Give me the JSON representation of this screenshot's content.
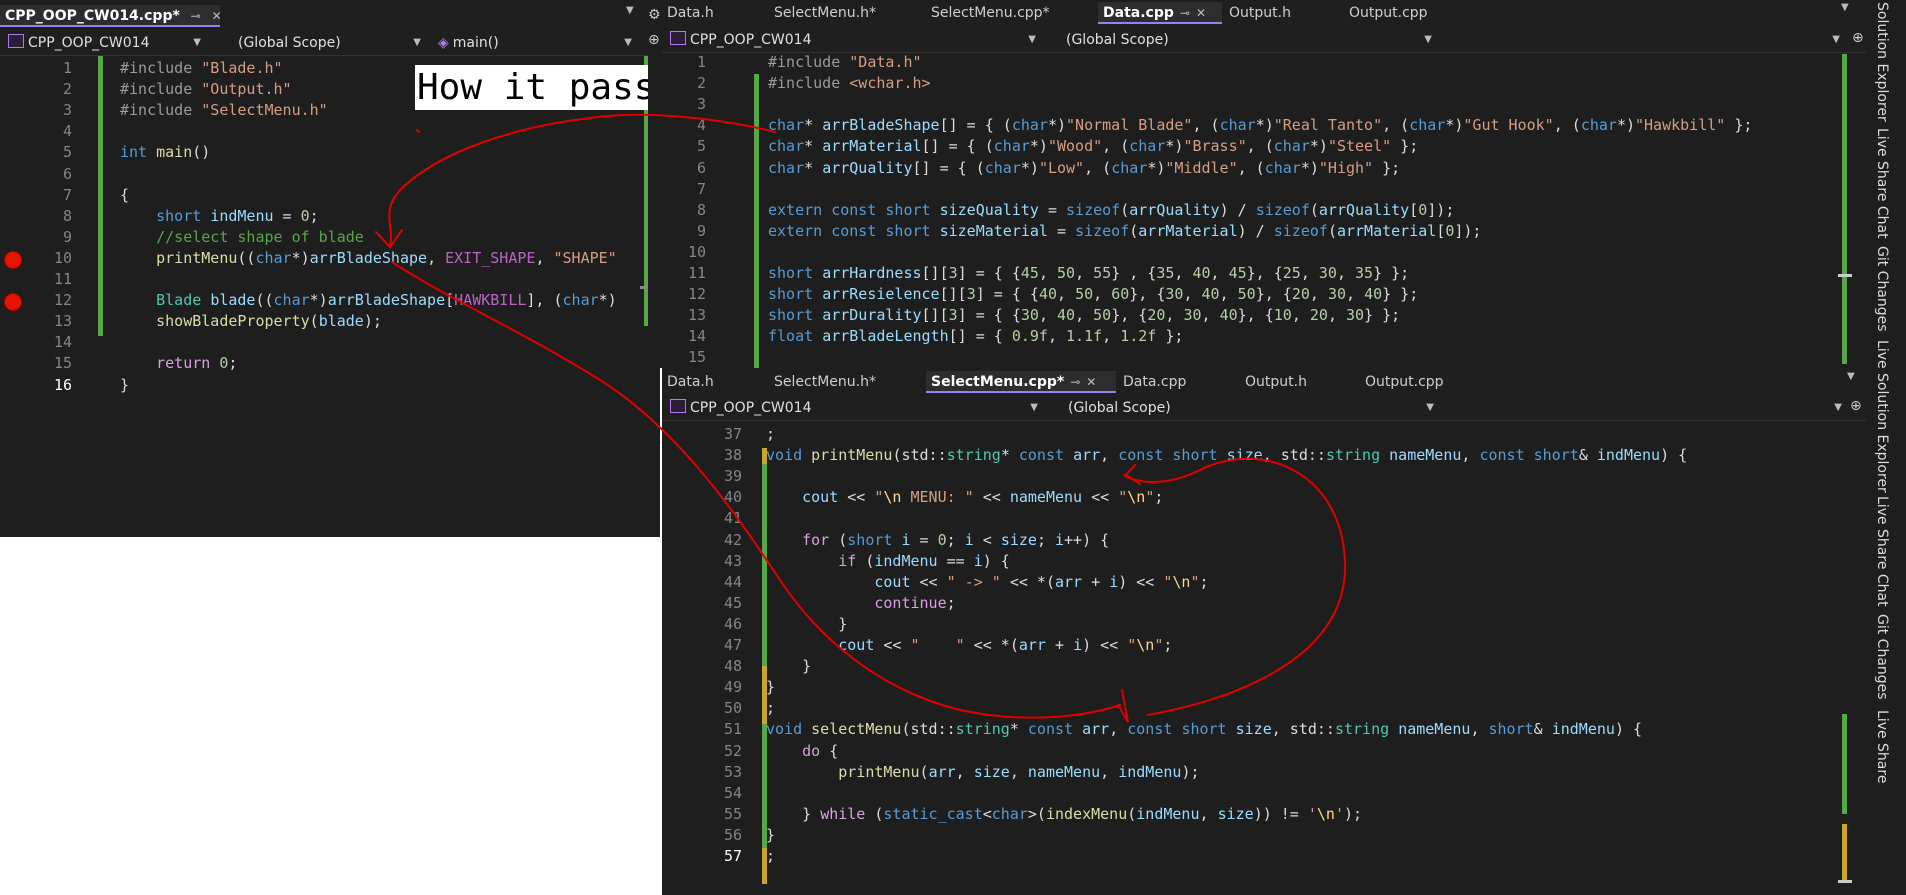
{
  "left_pane": {
    "tabs": [
      {
        "label": "CPP_OOP_CW014.cpp*"
      }
    ],
    "nav": {
      "project": "CPP_OOP_CW014",
      "scope": "(Global Scope)",
      "member": "main()"
    },
    "lines": [
      {
        "n": "1",
        "t": "#include \"Blade.h\""
      },
      {
        "n": "2",
        "t": "#include \"Output.h\""
      },
      {
        "n": "3",
        "t": "#include \"SelectMenu.h\""
      },
      {
        "n": "4",
        "t": ""
      },
      {
        "n": "5",
        "t": "int main()"
      },
      {
        "n": "6",
        "t": ""
      },
      {
        "n": "7",
        "t": "{"
      },
      {
        "n": "8",
        "t": "    short indMenu = 0;"
      },
      {
        "n": "9",
        "t": "    //select shape of blade"
      },
      {
        "n": "10",
        "t": "    printMenu((char*)arrBladeShape, EXIT_SHAPE, \"SHAPE\""
      },
      {
        "n": "11",
        "t": ""
      },
      {
        "n": "12",
        "t": "    Blade blade((char*)arrBladeShape[HAWKBILL], (char*)"
      },
      {
        "n": "13",
        "t": "    showBladeProperty(blade);"
      },
      {
        "n": "14",
        "t": ""
      },
      {
        "n": "15",
        "t": "    return 0;"
      },
      {
        "n": "16",
        "t": "}"
      }
    ]
  },
  "annotation": {
    "text": "How it pass?"
  },
  "top_right_pane": {
    "tabs": [
      {
        "label": "Data.h"
      },
      {
        "label": "SelectMenu.h*"
      },
      {
        "label": "SelectMenu.cpp*"
      },
      {
        "label": "Data.cpp"
      },
      {
        "label": "Output.h"
      },
      {
        "label": "Output.cpp"
      }
    ],
    "nav": {
      "project": "CPP_OOP_CW014",
      "scope": "(Global Scope)"
    },
    "lines": [
      {
        "n": "1",
        "t": "#include \"Data.h\""
      },
      {
        "n": "2",
        "t": "#include <wchar.h>"
      },
      {
        "n": "3",
        "t": ""
      },
      {
        "n": "4",
        "t": "char* arrBladeShape[] = { (char*)\"Normal Blade\", (char*)\"Real Tanto\", (char*)\"Gut Hook\", (char*)\"Hawkbill\" };"
      },
      {
        "n": "5",
        "t": "char* arrMaterial[] = { (char*)\"Wood\", (char*)\"Brass\", (char*)\"Steel\" };"
      },
      {
        "n": "6",
        "t": "char* arrQuality[] = { (char*)\"Low\", (char*)\"Middle\", (char*)\"High\" };"
      },
      {
        "n": "7",
        "t": ""
      },
      {
        "n": "8",
        "t": "extern const short sizeQuality = sizeof(arrQuality) / sizeof(arrQuality[0]);"
      },
      {
        "n": "9",
        "t": "extern const short sizeMaterial = sizeof(arrMaterial) / sizeof(arrMaterial[0]);"
      },
      {
        "n": "10",
        "t": ""
      },
      {
        "n": "11",
        "t": "short arrHardness[][3] = { {45, 50, 55} , {35, 40, 45}, {25, 30, 35} };"
      },
      {
        "n": "12",
        "t": "short arrResielence[][3] = { {40, 50, 60}, {30, 40, 50}, {20, 30, 40} };"
      },
      {
        "n": "13",
        "t": "short arrDurality[][3] = { {30, 40, 50}, {20, 30, 40}, {10, 20, 30} };"
      },
      {
        "n": "14",
        "t": "float arrBladeLength[] = { 0.9f, 1.1f, 1.2f };"
      },
      {
        "n": "15",
        "t": ""
      }
    ]
  },
  "bottom_right_pane": {
    "tabs": [
      {
        "label": "Data.h"
      },
      {
        "label": "SelectMenu.h*"
      },
      {
        "label": "SelectMenu.cpp*"
      },
      {
        "label": "Data.cpp"
      },
      {
        "label": "Output.h"
      },
      {
        "label": "Output.cpp"
      }
    ],
    "nav": {
      "project": "CPP_OOP_CW014",
      "scope": "(Global Scope)"
    },
    "lines": [
      {
        "n": "37",
        "t": ";"
      },
      {
        "n": "38",
        "t": "void printMenu(std::string* const arr, const short size, std::string nameMenu, const short& indMenu) {"
      },
      {
        "n": "39",
        "t": ""
      },
      {
        "n": "40",
        "t": "    cout << \"\\n MENU: \" << nameMenu << \"\\n\";"
      },
      {
        "n": "41",
        "t": ""
      },
      {
        "n": "42",
        "t": "    for (short i = 0; i < size; i++) {"
      },
      {
        "n": "43",
        "t": "        if (indMenu == i) {"
      },
      {
        "n": "44",
        "t": "            cout << \" -> \" << *(arr + i) << \"\\n\";"
      },
      {
        "n": "45",
        "t": "            continue;"
      },
      {
        "n": "46",
        "t": "        }"
      },
      {
        "n": "47",
        "t": "        cout << \"    \" << *(arr + i) << \"\\n\";"
      },
      {
        "n": "48",
        "t": "    }"
      },
      {
        "n": "49",
        "t": "}"
      },
      {
        "n": "50",
        "t": ";"
      },
      {
        "n": "51",
        "t": "void selectMenu(std::string* const arr, const short size, std::string nameMenu, short& indMenu) {"
      },
      {
        "n": "52",
        "t": "    do {"
      },
      {
        "n": "53",
        "t": "        printMenu(arr, size, nameMenu, indMenu);"
      },
      {
        "n": "54",
        "t": ""
      },
      {
        "n": "55",
        "t": "    } while (static_cast<char>(indexMenu(indMenu, size)) != '\\n');"
      },
      {
        "n": "56",
        "t": "}"
      },
      {
        "n": "57",
        "t": ";"
      }
    ]
  },
  "side_panel": {
    "labels": [
      "Solution Explorer",
      "Live Share Chat",
      "Git Changes",
      "Live Solution Explorer",
      "Live Share Chat",
      "Git Changes",
      "Live Share"
    ]
  },
  "colors": {
    "background": "#1e1e1e",
    "annotation_stroke": "#e00000",
    "change_bar": "#57a64a",
    "accent": "#9184ee"
  }
}
